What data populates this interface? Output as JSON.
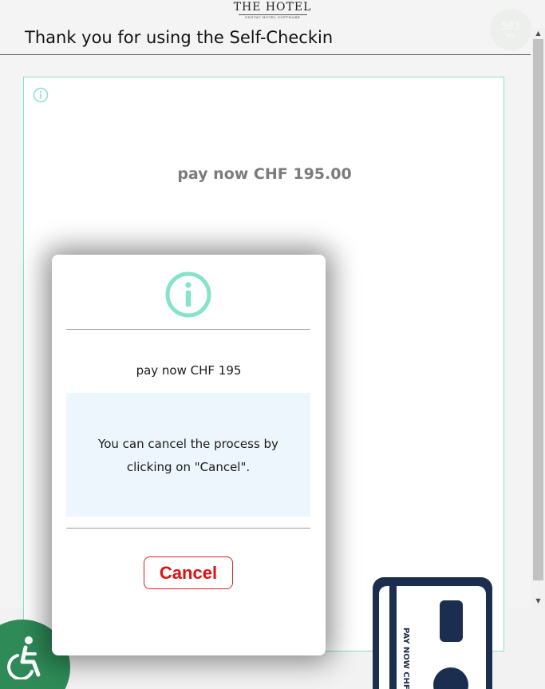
{
  "header": {
    "logo_name": "THE HOTEL",
    "logo_tagline": "ONSTAY HOTEL SOFTWARE",
    "title": "Thank you for using the Self-Checkin",
    "timer_value": "583",
    "timer_unit": "sec"
  },
  "payment_card": {
    "info_icon": "info-circle-icon",
    "amount_text": "pay now CHF 195.00"
  },
  "modal": {
    "icon": "info-circle-icon",
    "amount_text": "pay now CHF 195",
    "note_text": "You can cancel the process by clicking on \"Cancel\".",
    "cancel_label": "Cancel"
  },
  "card_illustration": {
    "label": "PAY NOW CHF"
  },
  "accessibility": {
    "icon": "wheelchair-icon"
  },
  "scrollbar": {
    "up_icon": "▲",
    "down_icon": "▼"
  },
  "colors": {
    "accent_teal": "#86e2c8",
    "cancel_red": "#e01010",
    "accessibility_green": "#2e8b57",
    "card_navy": "#1b2e4f",
    "note_background": "#edf5fd"
  }
}
